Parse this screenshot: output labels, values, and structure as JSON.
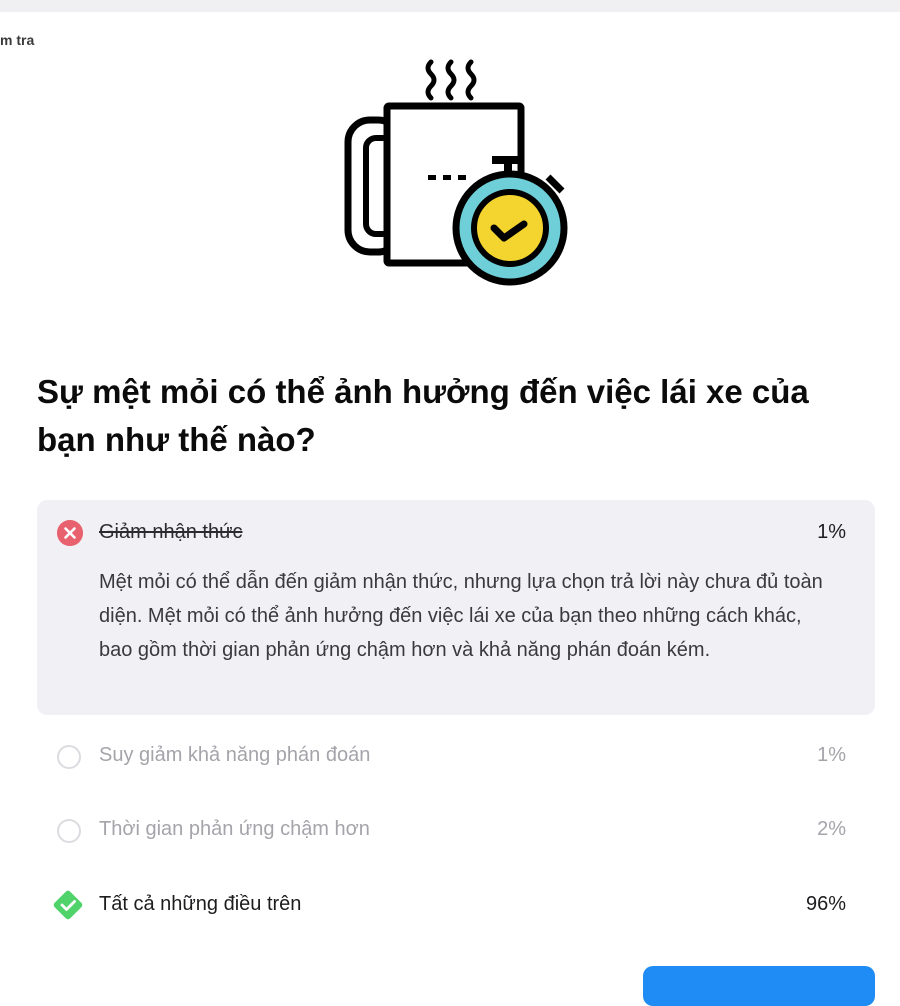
{
  "breadcrumb": "m tra",
  "question": "Sự mệt mỏi có thể ảnh hưởng đến việc lái xe của bạn như thế nào?",
  "answers": [
    {
      "label": "Giảm nhận thức",
      "percent": "1%",
      "state": "selected-wrong",
      "explanation": "Mệt mỏi có thể dẫn đến giảm nhận thức, nhưng lựa chọn trả lời này chưa đủ toàn diện. Mệt mỏi có thể ảnh hưởng đến việc lái xe của bạn theo những cách khác, bao gồm thời gian phản ứng chậm hơn và khả năng phán đoán kém."
    },
    {
      "label": "Suy giảm khả năng phán đoán",
      "percent": "1%",
      "state": "unselected"
    },
    {
      "label": "Thời gian phản ứng chậm hơn",
      "percent": "2%",
      "state": "unselected"
    },
    {
      "label": "Tất cả những điều trên",
      "percent": "96%",
      "state": "correct"
    }
  ],
  "colors": {
    "wrong": "#e8616e",
    "correct": "#4fd36a",
    "accent_blue": "#1f8bf5",
    "stopwatch_ring": "#6fcfd9",
    "stopwatch_face": "#f4d42e",
    "selected_bg": "#f1f0f4"
  },
  "icons": {
    "illustration": "coffee-mug-stopwatch-icon",
    "wrong": "x-circle-icon",
    "correct": "check-diamond-icon",
    "radio": "radio-circle-icon"
  }
}
